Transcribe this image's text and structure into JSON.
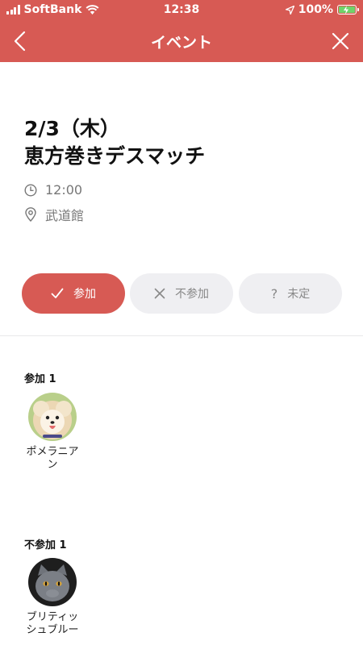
{
  "status_bar": {
    "carrier": "SoftBank",
    "time": "12:38",
    "battery": "100%"
  },
  "nav": {
    "title": "イベント"
  },
  "event": {
    "date": "2/3（木）",
    "title": "恵方巻きデスマッチ",
    "time": "12:00",
    "place": "武道館"
  },
  "response_buttons": {
    "join": "参加",
    "decline": "不参加",
    "undecided": "未定"
  },
  "attending": {
    "label": "参加 1",
    "members": [
      {
        "name": "ポメラニアン"
      }
    ]
  },
  "declined": {
    "label": "不参加 1",
    "members": [
      {
        "name": "ブリティッシュブルー"
      }
    ]
  },
  "colors": {
    "accent": "#d75a54",
    "button_inactive": "#efeff2"
  }
}
